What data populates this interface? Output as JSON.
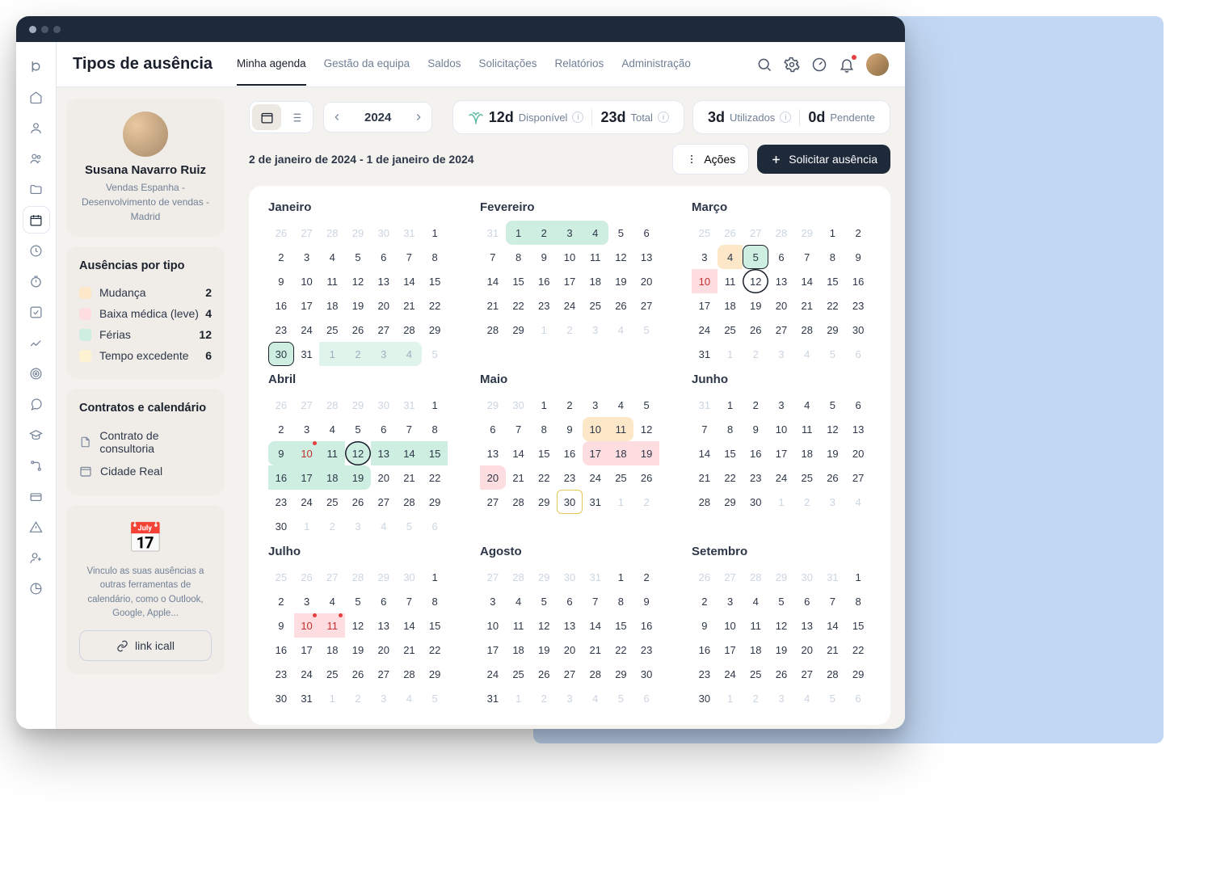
{
  "header": {
    "title": "Tipos de ausência",
    "nav": [
      "Minha agenda",
      "Gestão da equipa",
      "Saldos",
      "Solicitações",
      "Relatórios",
      "Administração"
    ],
    "active_nav": 0
  },
  "profile": {
    "name": "Susana Navarro Ruiz",
    "role": "Vendas Espanha - Desenvolvimento de vendas - Madrid"
  },
  "types": {
    "title": "Ausências por tipo",
    "items": [
      {
        "label": "Mudança",
        "count": 2,
        "color": "#fce8c8"
      },
      {
        "label": "Baixa médica (leve)",
        "count": 4,
        "color": "#fddde0"
      },
      {
        "label": "Férias",
        "count": 12,
        "color": "#cdeee0"
      },
      {
        "label": "Tempo excedente",
        "count": 6,
        "color": "#fdf3d1"
      }
    ]
  },
  "contracts": {
    "title": "Contratos e calendário",
    "items": [
      "Contrato de consultoria",
      "Cidade Real"
    ]
  },
  "ical": {
    "text": "Vinculo as suas ausências a outras ferramentas de calendário, como o Outlook, Google, Apple...",
    "button": "link icall"
  },
  "year": "2024",
  "date_range": "2 de janeiro de 2024 - 1 de janeiro de 2024",
  "stats": {
    "available": {
      "value": "12d",
      "label": "Disponível"
    },
    "total": {
      "value": "23d",
      "label": "Total"
    },
    "used": {
      "value": "3d",
      "label": "Utilizados"
    },
    "pending": {
      "value": "0d",
      "label": "Pendente"
    }
  },
  "actions_btn": "Ações",
  "request_btn": "Solicitar ausência",
  "months": [
    "Janeiro",
    "Fevereiro",
    "Março",
    "Abril",
    "Maio",
    "Junho",
    "Julho",
    "Agosto",
    "Setembro"
  ],
  "grids": {
    "jan": {
      "lead": 6,
      "days": 31,
      "trail": 5
    },
    "fev": {
      "lead": 1,
      "days": 29,
      "trail": 5
    },
    "mar": {
      "lead": 5,
      "days": 31,
      "trail": 6
    },
    "abr": {
      "lead": 6,
      "days": 30,
      "trail": 6
    },
    "mai": {
      "lead": 2,
      "days": 31,
      "trail": 2
    },
    "jun": {
      "lead": 1,
      "days": 30,
      "trail": 4
    },
    "jul": {
      "lead": 6,
      "days": 31,
      "trail": 5
    },
    "ago": {
      "lead": 5,
      "days": 31,
      "trail": 6
    },
    "set": {
      "lead": 6,
      "days": 30,
      "trail": 6
    }
  }
}
